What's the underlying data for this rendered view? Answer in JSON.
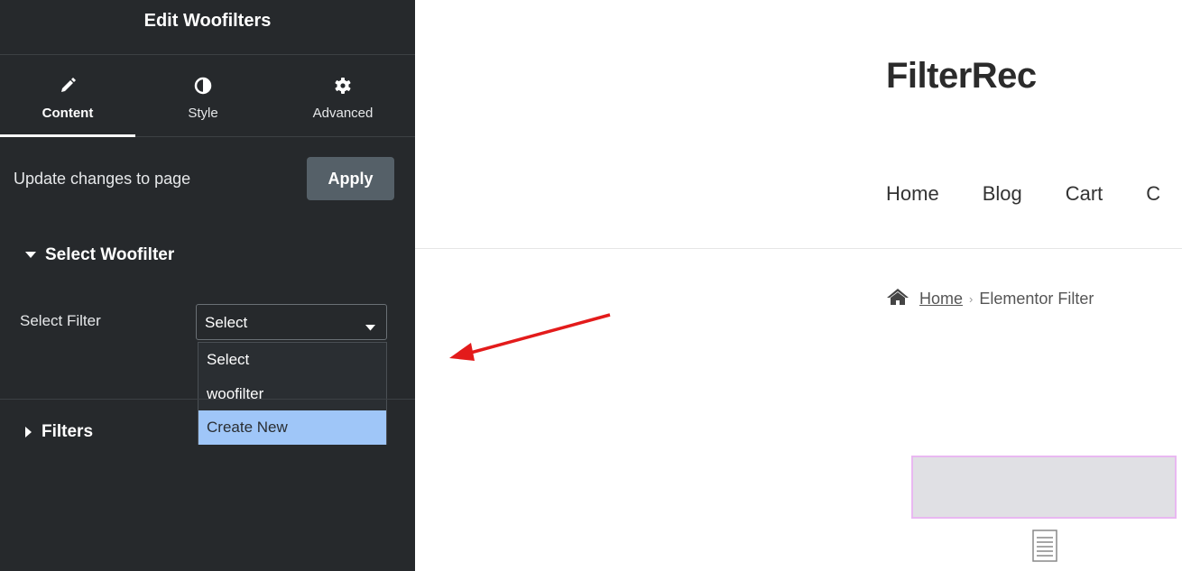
{
  "panel": {
    "title": "Edit Woofilters",
    "tabs": [
      {
        "label": "Content",
        "icon": "pencil-icon"
      },
      {
        "label": "Style",
        "icon": "contrast-icon"
      },
      {
        "label": "Advanced",
        "icon": "gear-icon"
      }
    ],
    "update_text": "Update changes to page",
    "apply_label": "Apply",
    "section_select": "Select Woofilter",
    "field_label": "Select Filter",
    "select_value": "Select",
    "dropdown_options": [
      "Select",
      "woofilter",
      "Create New"
    ],
    "section_filters": "Filters"
  },
  "preview": {
    "site_title": "FilterRec",
    "nav": [
      "Home",
      "Blog",
      "Cart",
      "C"
    ],
    "breadcrumb": {
      "home": "Home",
      "current": "Elementor Filter"
    }
  },
  "colors": {
    "panel_bg": "#26292c",
    "apply_bg": "#556068",
    "highlight": "#9fc6f8",
    "arrow": "#e31b1b",
    "placeholder_border": "#e9b8f1"
  }
}
